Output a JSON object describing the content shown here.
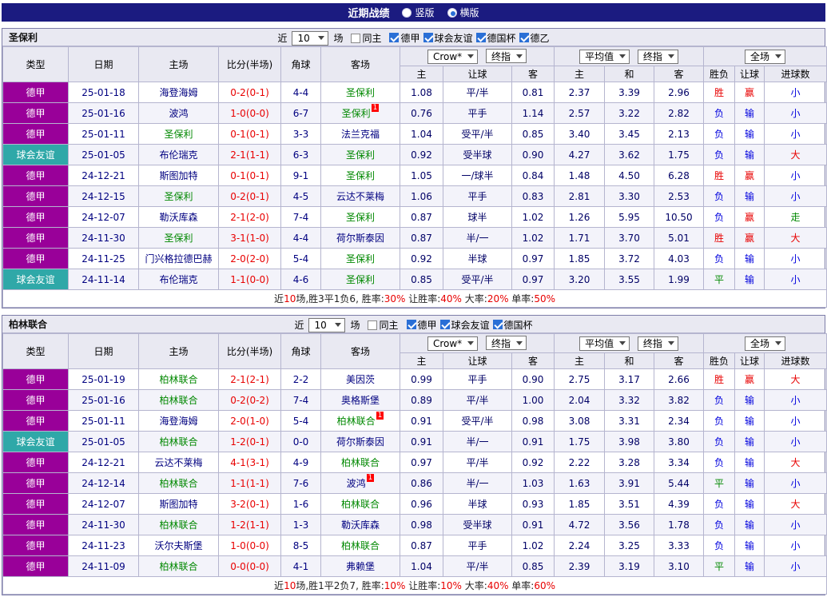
{
  "topbar": {
    "title": "近期战绩",
    "radios": [
      {
        "label": "竖版",
        "selected": false
      },
      {
        "label": "横版",
        "selected": true
      }
    ]
  },
  "colors": {
    "德甲": "#990099",
    "球会友谊": "#2fa8a8",
    "胜": "#e80000",
    "负": "#0000dd",
    "平": "#008800",
    "赢": "#e80000",
    "输": "#0000dd",
    "大": "#e80000",
    "小": "#0000dd",
    "走": "#008800"
  },
  "table_header": {
    "cols_left": [
      "类型",
      "日期",
      "主场",
      "比分(半场)",
      "角球",
      "客场"
    ],
    "asia_labels": [
      "主",
      "让球",
      "客"
    ],
    "europe_labels": [
      "主",
      "和",
      "客"
    ],
    "result_labels": [
      "胜负",
      "让球",
      "进球数"
    ]
  },
  "sections": [
    {
      "team": "圣保利",
      "filters": {
        "prefix": "近",
        "count": "10",
        "suffix": "场",
        "same_home": "同主",
        "same_home_checked": false,
        "leagues": [
          {
            "label": "德甲",
            "checked": true
          },
          {
            "label": "球会友谊",
            "checked": true
          },
          {
            "label": "德国杯",
            "checked": true
          },
          {
            "label": "德乙",
            "checked": true
          }
        ]
      },
      "combos": {
        "asia_source": "Crow*",
        "asia_time": "终指",
        "europe_source": "平均值",
        "europe_time": "终指",
        "scope": "全场"
      },
      "rows": [
        {
          "type": "德甲",
          "date": "25-01-18",
          "home": "海登海姆",
          "home_team": false,
          "score": "0-2(0-1)",
          "corner": "4-4",
          "away": "圣保利",
          "away_team": true,
          "ah": [
            "1.08",
            "平/半",
            "0.81"
          ],
          "eu": [
            "2.37",
            "3.39",
            "2.96"
          ],
          "res": "胜",
          "ahres": "赢",
          "goal": "小"
        },
        {
          "type": "德甲",
          "date": "25-01-16",
          "home": "波鸿",
          "home_team": false,
          "score": "1-0(0-0)",
          "corner": "6-7",
          "away": "圣保利",
          "away_team": true,
          "away_rc": 1,
          "ah": [
            "0.76",
            "平手",
            "1.14"
          ],
          "eu": [
            "2.57",
            "3.22",
            "2.82"
          ],
          "res": "负",
          "ahres": "输",
          "goal": "小"
        },
        {
          "type": "德甲",
          "date": "25-01-11",
          "home": "圣保利",
          "home_team": true,
          "score": "0-1(0-1)",
          "corner": "3-3",
          "away": "法兰克福",
          "away_team": false,
          "ah": [
            "1.04",
            "受平/半",
            "0.85"
          ],
          "eu": [
            "3.40",
            "3.45",
            "2.13"
          ],
          "res": "负",
          "ahres": "输",
          "goal": "小"
        },
        {
          "type": "球会友谊",
          "date": "25-01-05",
          "home": "布伦瑞克",
          "home_team": false,
          "score": "2-1(1-1)",
          "corner": "6-3",
          "away": "圣保利",
          "away_team": true,
          "ah": [
            "0.92",
            "受半球",
            "0.90"
          ],
          "eu": [
            "4.27",
            "3.62",
            "1.75"
          ],
          "res": "负",
          "ahres": "输",
          "goal": "大"
        },
        {
          "type": "德甲",
          "date": "24-12-21",
          "home": "斯图加特",
          "home_team": false,
          "score": "0-1(0-1)",
          "corner": "9-1",
          "away": "圣保利",
          "away_team": true,
          "ah": [
            "1.05",
            "一/球半",
            "0.84"
          ],
          "eu": [
            "1.48",
            "4.50",
            "6.28"
          ],
          "res": "胜",
          "ahres": "赢",
          "goal": "小"
        },
        {
          "type": "德甲",
          "date": "24-12-15",
          "home": "圣保利",
          "home_team": true,
          "score": "0-2(0-1)",
          "corner": "4-5",
          "away": "云达不莱梅",
          "away_team": false,
          "ah": [
            "1.06",
            "平手",
            "0.83"
          ],
          "eu": [
            "2.81",
            "3.30",
            "2.53"
          ],
          "res": "负",
          "ahres": "输",
          "goal": "小"
        },
        {
          "type": "德甲",
          "date": "24-12-07",
          "home": "勒沃库森",
          "home_team": false,
          "score": "2-1(2-0)",
          "corner": "7-4",
          "away": "圣保利",
          "away_team": true,
          "ah": [
            "0.87",
            "球半",
            "1.02"
          ],
          "eu": [
            "1.26",
            "5.95",
            "10.50"
          ],
          "res": "负",
          "ahres": "赢",
          "goal": "走"
        },
        {
          "type": "德甲",
          "date": "24-11-30",
          "home": "圣保利",
          "home_team": true,
          "score": "3-1(1-0)",
          "corner": "4-4",
          "away": "荷尔斯泰因",
          "away_team": false,
          "ah": [
            "0.87",
            "半/一",
            "1.02"
          ],
          "eu": [
            "1.71",
            "3.70",
            "5.01"
          ],
          "res": "胜",
          "ahres": "赢",
          "goal": "大"
        },
        {
          "type": "德甲",
          "date": "24-11-25",
          "home": "门兴格拉德巴赫",
          "home_team": false,
          "score": "2-0(2-0)",
          "corner": "5-4",
          "away": "圣保利",
          "away_team": true,
          "ah": [
            "0.92",
            "半球",
            "0.97"
          ],
          "eu": [
            "1.85",
            "3.72",
            "4.03"
          ],
          "res": "负",
          "ahres": "输",
          "goal": "小"
        },
        {
          "type": "球会友谊",
          "date": "24-11-14",
          "home": "布伦瑞克",
          "home_team": false,
          "score": "1-1(0-0)",
          "corner": "4-6",
          "away": "圣保利",
          "away_team": true,
          "ah": [
            "0.85",
            "受平/半",
            "0.97"
          ],
          "eu": [
            "3.20",
            "3.55",
            "1.99"
          ],
          "res": "平",
          "ahres": "输",
          "goal": "小"
        }
      ],
      "summary": [
        {
          "t": "近",
          "c": "k"
        },
        {
          "t": "10",
          "c": "r"
        },
        {
          "t": "场,胜3平1负6, 胜率:",
          "c": "k"
        },
        {
          "t": "30%",
          "c": "r"
        },
        {
          "t": " 让胜率:",
          "c": "k"
        },
        {
          "t": "40%",
          "c": "r"
        },
        {
          "t": " 大率:",
          "c": "k"
        },
        {
          "t": "20%",
          "c": "r"
        },
        {
          "t": " 单率:",
          "c": "k"
        },
        {
          "t": "50%",
          "c": "r"
        }
      ]
    },
    {
      "team": "柏林联合",
      "filters": {
        "prefix": "近",
        "count": "10",
        "suffix": "场",
        "same_home": "同主",
        "same_home_checked": false,
        "leagues": [
          {
            "label": "德甲",
            "checked": true
          },
          {
            "label": "球会友谊",
            "checked": true
          },
          {
            "label": "德国杯",
            "checked": true
          }
        ]
      },
      "combos": {
        "asia_source": "Crow*",
        "asia_time": "终指",
        "europe_source": "平均值",
        "europe_time": "终指",
        "scope": "全场"
      },
      "rows": [
        {
          "type": "德甲",
          "date": "25-01-19",
          "home": "柏林联合",
          "home_team": true,
          "score": "2-1(2-1)",
          "corner": "2-2",
          "away": "美因茨",
          "away_team": false,
          "ah": [
            "0.99",
            "平手",
            "0.90"
          ],
          "eu": [
            "2.75",
            "3.17",
            "2.66"
          ],
          "res": "胜",
          "ahres": "赢",
          "goal": "大"
        },
        {
          "type": "德甲",
          "date": "25-01-16",
          "home": "柏林联合",
          "home_team": true,
          "score": "0-2(0-2)",
          "corner": "7-4",
          "away": "奥格斯堡",
          "away_team": false,
          "ah": [
            "0.89",
            "平/半",
            "1.00"
          ],
          "eu": [
            "2.04",
            "3.32",
            "3.82"
          ],
          "res": "负",
          "ahres": "输",
          "goal": "小"
        },
        {
          "type": "德甲",
          "date": "25-01-11",
          "home": "海登海姆",
          "home_team": false,
          "score": "2-0(1-0)",
          "corner": "5-4",
          "away": "柏林联合",
          "away_team": true,
          "away_rc": 1,
          "ah": [
            "0.91",
            "受平/半",
            "0.98"
          ],
          "eu": [
            "3.08",
            "3.31",
            "2.34"
          ],
          "res": "负",
          "ahres": "输",
          "goal": "小"
        },
        {
          "type": "球会友谊",
          "date": "25-01-05",
          "home": "柏林联合",
          "home_team": true,
          "score": "1-2(0-1)",
          "corner": "0-0",
          "away": "荷尔斯泰因",
          "away_team": false,
          "ah": [
            "0.91",
            "半/一",
            "0.91"
          ],
          "eu": [
            "1.75",
            "3.98",
            "3.80"
          ],
          "res": "负",
          "ahres": "输",
          "goal": "小"
        },
        {
          "type": "德甲",
          "date": "24-12-21",
          "home": "云达不莱梅",
          "home_team": false,
          "score": "4-1(3-1)",
          "corner": "4-9",
          "away": "柏林联合",
          "away_team": true,
          "ah": [
            "0.97",
            "平/半",
            "0.92"
          ],
          "eu": [
            "2.22",
            "3.28",
            "3.34"
          ],
          "res": "负",
          "ahres": "输",
          "goal": "大"
        },
        {
          "type": "德甲",
          "date": "24-12-14",
          "home": "柏林联合",
          "home_team": true,
          "score": "1-1(1-1)",
          "corner": "7-6",
          "away": "波鸿",
          "away_team": false,
          "away_rc": 1,
          "ah": [
            "0.86",
            "半/一",
            "1.03"
          ],
          "eu": [
            "1.63",
            "3.91",
            "5.44"
          ],
          "res": "平",
          "ahres": "输",
          "goal": "小"
        },
        {
          "type": "德甲",
          "date": "24-12-07",
          "home": "斯图加特",
          "home_team": false,
          "score": "3-2(0-1)",
          "corner": "1-6",
          "away": "柏林联合",
          "away_team": true,
          "ah": [
            "0.96",
            "半球",
            "0.93"
          ],
          "eu": [
            "1.85",
            "3.51",
            "4.39"
          ],
          "res": "负",
          "ahres": "输",
          "goal": "大"
        },
        {
          "type": "德甲",
          "date": "24-11-30",
          "home": "柏林联合",
          "home_team": true,
          "score": "1-2(1-1)",
          "corner": "1-3",
          "away": "勒沃库森",
          "away_team": false,
          "ah": [
            "0.98",
            "受半球",
            "0.91"
          ],
          "eu": [
            "4.72",
            "3.56",
            "1.78"
          ],
          "res": "负",
          "ahres": "输",
          "goal": "小"
        },
        {
          "type": "德甲",
          "date": "24-11-23",
          "home": "沃尔夫斯堡",
          "home_team": false,
          "score": "1-0(0-0)",
          "corner": "8-5",
          "away": "柏林联合",
          "away_team": true,
          "ah": [
            "0.87",
            "平手",
            "1.02"
          ],
          "eu": [
            "2.24",
            "3.25",
            "3.33"
          ],
          "res": "负",
          "ahres": "输",
          "goal": "小"
        },
        {
          "type": "德甲",
          "date": "24-11-09",
          "home": "柏林联合",
          "home_team": true,
          "score": "0-0(0-0)",
          "corner": "4-1",
          "away": "弗赖堡",
          "away_team": false,
          "ah": [
            "1.04",
            "平/半",
            "0.85"
          ],
          "eu": [
            "2.39",
            "3.19",
            "3.10"
          ],
          "res": "平",
          "ahres": "输",
          "goal": "小"
        }
      ],
      "summary": [
        {
          "t": "近",
          "c": "k"
        },
        {
          "t": "10",
          "c": "r"
        },
        {
          "t": "场,胜1平2负7, 胜率:",
          "c": "k"
        },
        {
          "t": "10%",
          "c": "r"
        },
        {
          "t": " 让胜率:",
          "c": "k"
        },
        {
          "t": "10%",
          "c": "r"
        },
        {
          "t": " 大率:",
          "c": "k"
        },
        {
          "t": "40%",
          "c": "r"
        },
        {
          "t": " 单率:",
          "c": "k"
        },
        {
          "t": "60%",
          "c": "r"
        }
      ]
    }
  ]
}
